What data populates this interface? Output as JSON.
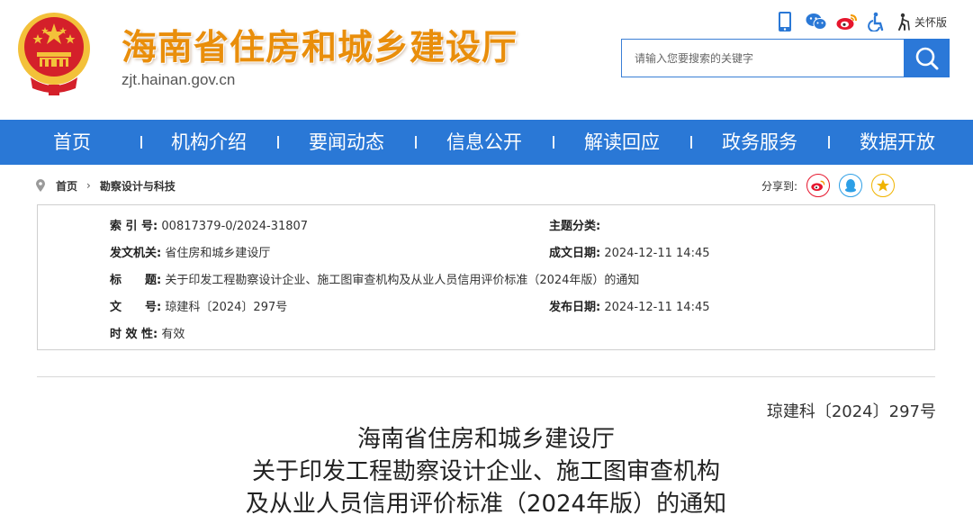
{
  "header": {
    "site_title": "海南省住房和城乡建设厅",
    "site_domain": "zjt.hainan.gov.cn",
    "tools": [
      {
        "icon": "mobile-icon",
        "color": "#2a78d6"
      },
      {
        "icon": "wechat-icon",
        "color": "#2a78d6"
      },
      {
        "icon": "weibo-icon",
        "color": "#e6162d"
      },
      {
        "icon": "accessibility-icon",
        "color": "#2a78d6"
      },
      {
        "icon": "elderly-mode-icon",
        "color": "#333333",
        "label": "关怀版"
      }
    ],
    "search": {
      "placeholder": "请输入您要搜索的关键字",
      "value": ""
    }
  },
  "nav": {
    "items": [
      "首页",
      "机构介绍",
      "要闻动态",
      "信息公开",
      "解读回应",
      "政务服务",
      "数据开放"
    ]
  },
  "breadcrumb": {
    "home": "首页",
    "current": "勘察设计与科技"
  },
  "share": {
    "label": "分享到:",
    "targets": [
      {
        "icon": "weibo-icon",
        "color": "#e6162d"
      },
      {
        "icon": "qq-icon",
        "color": "#2d9fe6"
      },
      {
        "icon": "qzone-icon",
        "color": "#f0b400"
      }
    ]
  },
  "info": {
    "index_label": "索 引 号:",
    "index_value": "00817379-0/2024-31807",
    "topic_label": "主题分类:",
    "topic_value": "",
    "issuer_label": "发文机关:",
    "issuer_value": "省住房和城乡建设厅",
    "created_label": "成文日期:",
    "created_value": "2024-12-11 14:45",
    "title_label": "标　　题:",
    "title_value": "关于印发工程勘察设计企业、施工图审查机构及从业人员信用评价标准（2024年版）的通知",
    "docno_label": "文　　号:",
    "docno_value": "琼建科〔2024〕297号",
    "published_label": "发布日期:",
    "published_value": "2024-12-11 14:45",
    "validity_label": "时 效 性:",
    "validity_value": "有效"
  },
  "document": {
    "number": "琼建科〔2024〕297号",
    "title_lines": [
      "海南省住房和城乡建设厅",
      "关于印发工程勘察设计企业、施工图审查机构",
      "及从业人员信用评价标准（2024年版）的通知"
    ]
  },
  "colors": {
    "brand_blue": "#2a78d6",
    "title_orange": "#e98e0b",
    "emblem_red": "#d4202a",
    "emblem_gold": "#f3c13a"
  }
}
